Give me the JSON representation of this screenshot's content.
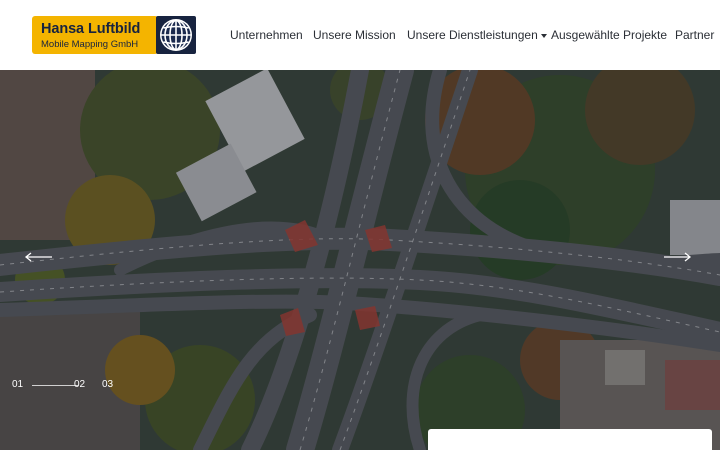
{
  "brand": {
    "name": "Hansa Luftbild",
    "tagline": "Mobile Mapping GmbH",
    "logo_color": "#f4b400",
    "text_color": "#17233f",
    "icon": "globe-icon"
  },
  "nav": {
    "items": [
      {
        "label": "Unternehmen"
      },
      {
        "label": "Unsere Mission"
      },
      {
        "label": "Unsere Dienstleistungen",
        "has_dropdown": true
      },
      {
        "label": "Ausgewählte Projekte"
      },
      {
        "label": "Partner"
      }
    ]
  },
  "hero": {
    "image_subject": "aerial view of highway interchange",
    "prev_icon": "arrow-left-icon",
    "next_icon": "arrow-right-icon",
    "slides": [
      "01",
      "02",
      "03"
    ],
    "active_slide": "01"
  }
}
